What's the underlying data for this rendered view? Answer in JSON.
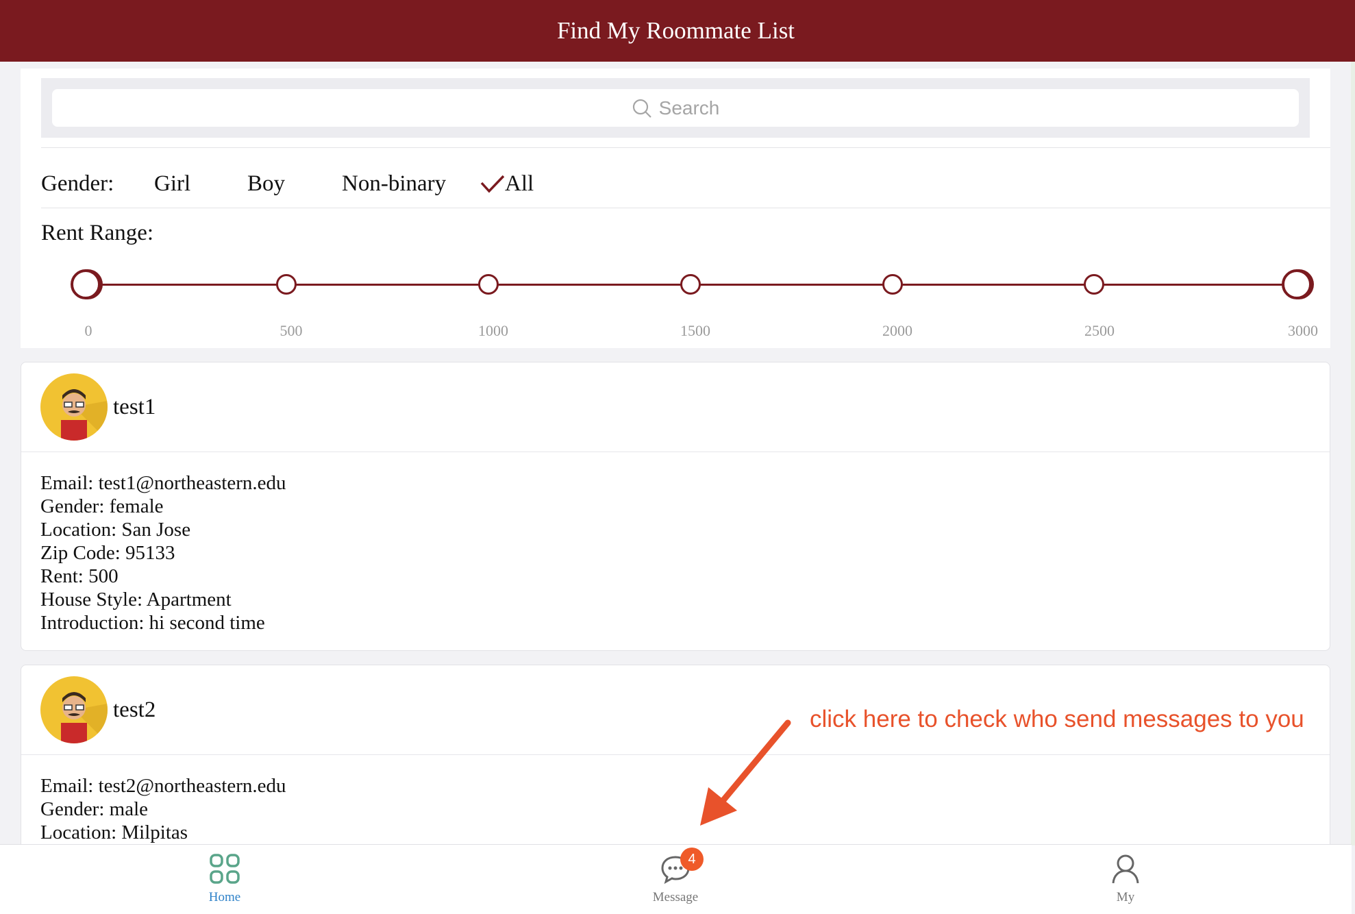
{
  "header": {
    "title": "Find My Roommate List"
  },
  "search": {
    "placeholder": "Search"
  },
  "filters": {
    "gender_label": "Gender:",
    "gender_options": [
      "Girl",
      "Boy",
      "Non-binary",
      "All"
    ],
    "gender_selected": "All",
    "rent_label": "Rent Range:",
    "rent_ticks": [
      "0",
      "500",
      "1000",
      "1500",
      "2000",
      "2500",
      "3000"
    ],
    "rent_min": 0,
    "rent_max": 3000,
    "rent_selected_min": 0,
    "rent_selected_max": 3000
  },
  "roommates": [
    {
      "name": "test1",
      "lines": [
        "Email: test1@northeastern.edu",
        "Gender: female",
        "Location: San Jose",
        "Zip Code: 95133",
        "Rent: 500",
        "House Style: Apartment",
        "Introduction: hi second time"
      ]
    },
    {
      "name": "test2",
      "lines": [
        "Email: test2@northeastern.edu",
        "Gender: male",
        "Location: Milpitas"
      ]
    }
  ],
  "annotation": {
    "text": "click here to check who send messages to you",
    "color": "#e8522b"
  },
  "tabbar": {
    "home": "Home",
    "message": "Message",
    "message_badge": "4",
    "my": "My"
  },
  "colors": {
    "brand": "#7a1a1f",
    "active_tab": "#2f82c9",
    "badge": "#ef5a29",
    "home_icon": "#5aa58a"
  }
}
